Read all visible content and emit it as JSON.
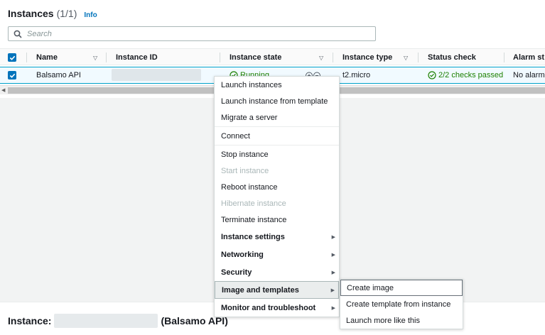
{
  "header": {
    "title": "Instances",
    "count": "(1/1)",
    "info": "Info"
  },
  "search": {
    "placeholder": "Search"
  },
  "table": {
    "columns": [
      "Name",
      "Instance ID",
      "Instance state",
      "Instance type",
      "Status check",
      "Alarm st"
    ],
    "row": {
      "name": "Balsamo API",
      "state": "Running",
      "type": "t2.micro",
      "status": "2/2 checks passed",
      "alarm": "No alarm"
    }
  },
  "context_menu": {
    "items": [
      "Launch instances",
      "Launch instance from template",
      "Migrate a server",
      "Connect",
      "Stop instance",
      "Start instance",
      "Reboot instance",
      "Hibernate instance",
      "Terminate instance",
      "Instance settings",
      "Networking",
      "Security",
      "Image and templates",
      "Monitor and troubleshoot"
    ]
  },
  "submenu": {
    "items": [
      "Create image",
      "Create template from instance",
      "Launch more like this"
    ]
  },
  "detail": {
    "label": "Instance:",
    "suffix": "(Balsamo API)"
  },
  "colors": {
    "accent": "#0073bb",
    "success": "#1d8102",
    "selected_row": "#f1faff"
  }
}
